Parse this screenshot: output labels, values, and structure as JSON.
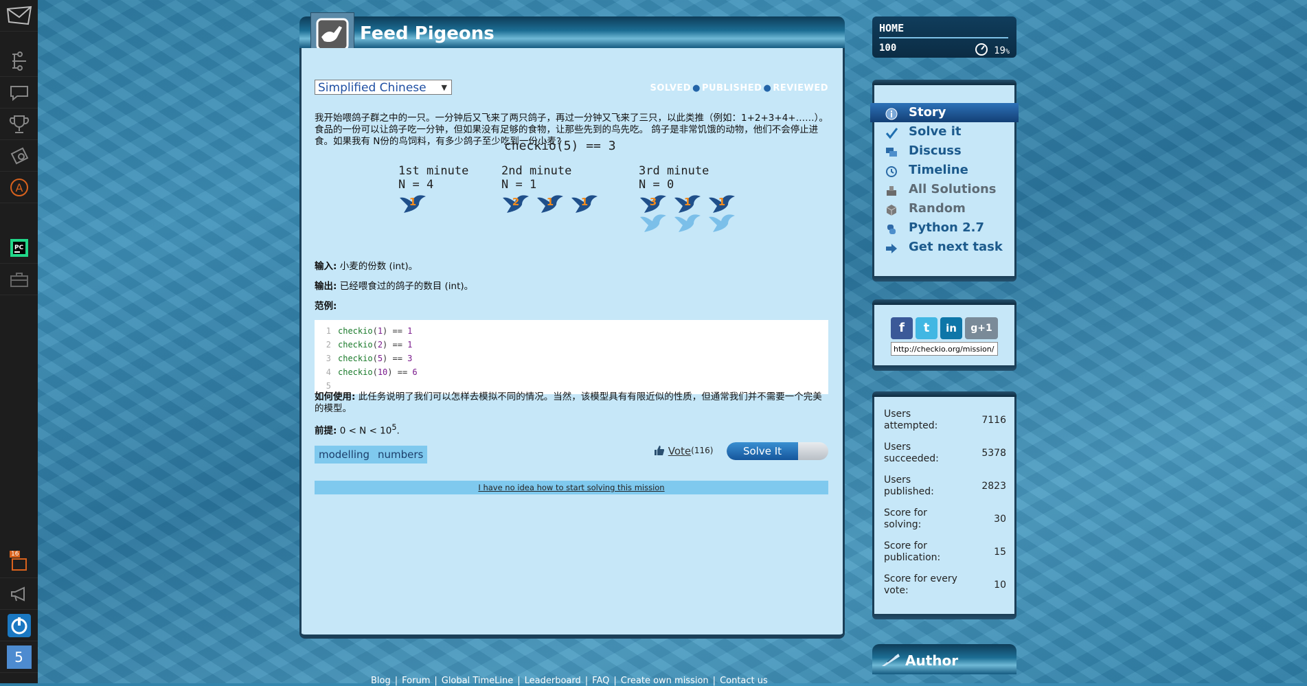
{
  "sidebar": {
    "notification_count": "16",
    "level": "5"
  },
  "mission": {
    "title": "Feed Pigeons",
    "language": "Simplified Chinese",
    "status": [
      "SOLVED",
      "PUBLISHED",
      "REVIEWED"
    ],
    "description": "我开始喂鸽子群之中的一只。一分钟后又飞来了两只鸽子，再过一分钟又飞来了三只，以此类推（例如：1+2+3+4+……）。食品的一份可以让鸽子吃一分钟，但如果没有足够的食物，让那些先到的鸟先吃。 鸽子是非常饥饿的动物，他们不会停止进食。如果我有 N份的鸟饲料，有多少鸽子至少吃到一份小麦?",
    "example_header": "checkio(5) == 3",
    "minutes": [
      {
        "label": "1st minute",
        "n": "N = 4",
        "birds": [
          "1"
        ]
      },
      {
        "label": "2nd minute",
        "n": "N = 1",
        "birds": [
          "2",
          "1",
          "1"
        ]
      },
      {
        "label": "3rd minute",
        "n": "N = 0",
        "birds": [
          "3",
          "1",
          "1"
        ]
      }
    ],
    "input_label": "输入:",
    "input_text": "小麦的份数 (int)。",
    "output_label": "输出:",
    "output_text": "已经喂食过的鸽子的数目 (int)。",
    "examples_label": "范例:",
    "code_lines": [
      {
        "num": "1",
        "fn": "checkio",
        "arg": "1",
        "eq": "==",
        "res": "1"
      },
      {
        "num": "2",
        "fn": "checkio",
        "arg": "2",
        "eq": "==",
        "res": "1"
      },
      {
        "num": "3",
        "fn": "checkio",
        "arg": "5",
        "eq": "==",
        "res": "3"
      },
      {
        "num": "4",
        "fn": "checkio",
        "arg": "10",
        "eq": "==",
        "res": "6"
      },
      {
        "num": "5",
        "fn": "",
        "arg": "",
        "eq": "",
        "res": ""
      }
    ],
    "usage_label": "如何使用:",
    "usage_text": "此任务说明了我们可以怎样去模拟不同的情况。当然，该模型具有有限近似的性质，但通常我们并不需要一个完美的模型。",
    "precondition_label": "前提:",
    "precondition_text": "0 < N < 10",
    "precondition_exp": "5",
    "tags": [
      "modelling",
      "numbers"
    ],
    "vote_label": "Vote",
    "vote_count": "(116)",
    "solve_button": "Solve It",
    "no_idea": "I have no idea how to start solving this mission"
  },
  "home": {
    "label": "HOME",
    "value": "100",
    "percent": "19",
    "percent_unit": "%",
    "progress_fraction": 1.0
  },
  "nav": [
    {
      "label": "Story",
      "icon": "info-icon",
      "active": true,
      "muted": false
    },
    {
      "label": "Solve it",
      "icon": "check-icon",
      "active": false,
      "muted": false
    },
    {
      "label": "Discuss",
      "icon": "chat-icon",
      "active": false,
      "muted": false
    },
    {
      "label": "Timeline",
      "icon": "clock-icon",
      "active": false,
      "muted": false
    },
    {
      "label": "All Solutions",
      "icon": "solutions-icon",
      "active": false,
      "muted": true
    },
    {
      "label": "Random",
      "icon": "box-icon",
      "active": false,
      "muted": true
    },
    {
      "label": "Python 2.7",
      "icon": "python-icon",
      "active": false,
      "muted": false
    },
    {
      "label": "Get next task",
      "icon": "arrow-right-icon",
      "active": false,
      "muted": false
    }
  ],
  "share": {
    "url": "http://checkio.org/mission/"
  },
  "stats": [
    {
      "label": "Users attempted:",
      "value": "7116"
    },
    {
      "label": "Users succeeded:",
      "value": "5378"
    },
    {
      "label": "Users published:",
      "value": "2823"
    },
    {
      "label": "Score for solving:",
      "value": "30"
    },
    {
      "label": "Score for publication:",
      "value": "15"
    },
    {
      "label": "Score for every vote:",
      "value": "10"
    }
  ],
  "author": {
    "title": "Author"
  },
  "footer": [
    "Blog",
    "Forum",
    "Global TimeLine",
    "Leaderboard",
    "FAQ",
    "Create own mission",
    "Contact us"
  ],
  "colors": {
    "accent": "#1c5a8c",
    "panel": "#c6e7f8",
    "tag": "#7fc9ee",
    "bird": "#1f4f8a",
    "bird_hungry": "#7bbfe9"
  }
}
